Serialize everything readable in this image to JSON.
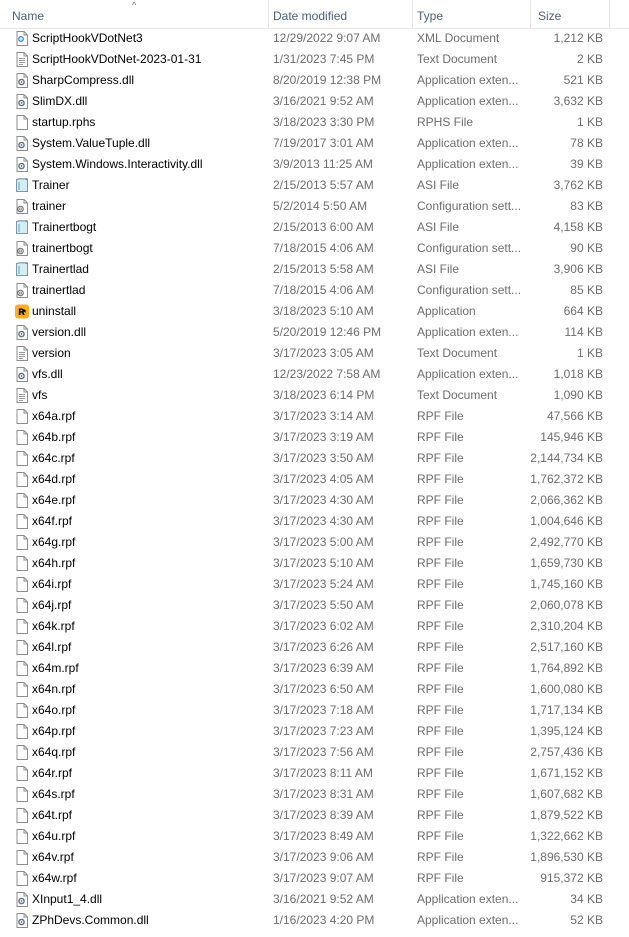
{
  "header": {
    "name": "Name",
    "date_modified": "Date modified",
    "type": "Type",
    "size": "Size",
    "sort_indicator": "^"
  },
  "files": [
    {
      "name": "ScriptHookVDotNet3",
      "date": "12/29/2022 9:07 AM",
      "type": "XML Document",
      "size": "1,212 KB",
      "icon": "xml-document-icon"
    },
    {
      "name": "ScriptHookVDotNet-2023-01-31",
      "date": "1/31/2023 7:45 PM",
      "type": "Text Document",
      "size": "2 KB",
      "icon": "text-document-icon"
    },
    {
      "name": "SharpCompress.dll",
      "date": "8/20/2019 12:38 PM",
      "type": "Application exten...",
      "size": "521 KB",
      "icon": "dll-icon"
    },
    {
      "name": "SlimDX.dll",
      "date": "3/16/2021 9:52 AM",
      "type": "Application exten...",
      "size": "3,632 KB",
      "icon": "dll-icon"
    },
    {
      "name": "startup.rphs",
      "date": "3/18/2023 3:30 PM",
      "type": "RPHS File",
      "size": "1 KB",
      "icon": "blank-file-icon"
    },
    {
      "name": "System.ValueTuple.dll",
      "date": "7/19/2017 3:01 AM",
      "type": "Application exten...",
      "size": "78 KB",
      "icon": "dll-icon"
    },
    {
      "name": "System.Windows.Interactivity.dll",
      "date": "3/9/2013 11:25 AM",
      "type": "Application exten...",
      "size": "39 KB",
      "icon": "dll-icon"
    },
    {
      "name": "Trainer",
      "date": "2/15/2013 5:57 AM",
      "type": "ASI File",
      "size": "3,762 KB",
      "icon": "asi-file-icon"
    },
    {
      "name": "trainer",
      "date": "5/2/2014 5:50 AM",
      "type": "Configuration sett...",
      "size": "83 KB",
      "icon": "config-file-icon"
    },
    {
      "name": "Trainertbogt",
      "date": "2/15/2013 6:00 AM",
      "type": "ASI File",
      "size": "4,158 KB",
      "icon": "asi-file-icon"
    },
    {
      "name": "trainertbogt",
      "date": "7/18/2015 4:06 AM",
      "type": "Configuration sett...",
      "size": "90 KB",
      "icon": "config-file-icon"
    },
    {
      "name": "Trainertlad",
      "date": "2/15/2013 5:58 AM",
      "type": "ASI File",
      "size": "3,906 KB",
      "icon": "asi-file-icon"
    },
    {
      "name": "trainertlad",
      "date": "7/18/2015 4:06 AM",
      "type": "Configuration sett...",
      "size": "85 KB",
      "icon": "config-file-icon"
    },
    {
      "name": "uninstall",
      "date": "3/18/2023 5:10 AM",
      "type": "Application",
      "size": "664 KB",
      "icon": "rockstar-app-icon"
    },
    {
      "name": "version.dll",
      "date": "5/20/2019 12:46 PM",
      "type": "Application exten...",
      "size": "114 KB",
      "icon": "dll-icon"
    },
    {
      "name": "version",
      "date": "3/17/2023 3:05 AM",
      "type": "Text Document",
      "size": "1 KB",
      "icon": "text-document-icon"
    },
    {
      "name": "vfs.dll",
      "date": "12/23/2022 7:58 AM",
      "type": "Application exten...",
      "size": "1,018 KB",
      "icon": "dll-icon"
    },
    {
      "name": "vfs",
      "date": "3/18/2023 6:14 PM",
      "type": "Text Document",
      "size": "1,090 KB",
      "icon": "text-document-icon"
    },
    {
      "name": "x64a.rpf",
      "date": "3/17/2023 3:14 AM",
      "type": "RPF File",
      "size": "47,566 KB",
      "icon": "blank-file-icon"
    },
    {
      "name": "x64b.rpf",
      "date": "3/17/2023 3:19 AM",
      "type": "RPF File",
      "size": "145,946 KB",
      "icon": "blank-file-icon"
    },
    {
      "name": "x64c.rpf",
      "date": "3/17/2023 3:50 AM",
      "type": "RPF File",
      "size": "2,144,734 KB",
      "icon": "blank-file-icon"
    },
    {
      "name": "x64d.rpf",
      "date": "3/17/2023 4:05 AM",
      "type": "RPF File",
      "size": "1,762,372 KB",
      "icon": "blank-file-icon"
    },
    {
      "name": "x64e.rpf",
      "date": "3/17/2023 4:30 AM",
      "type": "RPF File",
      "size": "2,066,362 KB",
      "icon": "blank-file-icon"
    },
    {
      "name": "x64f.rpf",
      "date": "3/17/2023 4:30 AM",
      "type": "RPF File",
      "size": "1,004,646 KB",
      "icon": "blank-file-icon"
    },
    {
      "name": "x64g.rpf",
      "date": "3/17/2023 5:00 AM",
      "type": "RPF File",
      "size": "2,492,770 KB",
      "icon": "blank-file-icon"
    },
    {
      "name": "x64h.rpf",
      "date": "3/17/2023 5:10 AM",
      "type": "RPF File",
      "size": "1,659,730 KB",
      "icon": "blank-file-icon"
    },
    {
      "name": "x64i.rpf",
      "date": "3/17/2023 5:24 AM",
      "type": "RPF File",
      "size": "1,745,160 KB",
      "icon": "blank-file-icon"
    },
    {
      "name": "x64j.rpf",
      "date": "3/17/2023 5:50 AM",
      "type": "RPF File",
      "size": "2,060,078 KB",
      "icon": "blank-file-icon"
    },
    {
      "name": "x64k.rpf",
      "date": "3/17/2023 6:02 AM",
      "type": "RPF File",
      "size": "2,310,204 KB",
      "icon": "blank-file-icon"
    },
    {
      "name": "x64l.rpf",
      "date": "3/17/2023 6:26 AM",
      "type": "RPF File",
      "size": "2,517,160 KB",
      "icon": "blank-file-icon"
    },
    {
      "name": "x64m.rpf",
      "date": "3/17/2023 6:39 AM",
      "type": "RPF File",
      "size": "1,764,892 KB",
      "icon": "blank-file-icon"
    },
    {
      "name": "x64n.rpf",
      "date": "3/17/2023 6:50 AM",
      "type": "RPF File",
      "size": "1,600,080 KB",
      "icon": "blank-file-icon"
    },
    {
      "name": "x64o.rpf",
      "date": "3/17/2023 7:18 AM",
      "type": "RPF File",
      "size": "1,717,134 KB",
      "icon": "blank-file-icon"
    },
    {
      "name": "x64p.rpf",
      "date": "3/17/2023 7:23 AM",
      "type": "RPF File",
      "size": "1,395,124 KB",
      "icon": "blank-file-icon"
    },
    {
      "name": "x64q.rpf",
      "date": "3/17/2023 7:56 AM",
      "type": "RPF File",
      "size": "2,757,436 KB",
      "icon": "blank-file-icon"
    },
    {
      "name": "x64r.rpf",
      "date": "3/17/2023 8:11 AM",
      "type": "RPF File",
      "size": "1,671,152 KB",
      "icon": "blank-file-icon"
    },
    {
      "name": "x64s.rpf",
      "date": "3/17/2023 8:31 AM",
      "type": "RPF File",
      "size": "1,607,682 KB",
      "icon": "blank-file-icon"
    },
    {
      "name": "x64t.rpf",
      "date": "3/17/2023 8:39 AM",
      "type": "RPF File",
      "size": "1,879,522 KB",
      "icon": "blank-file-icon"
    },
    {
      "name": "x64u.rpf",
      "date": "3/17/2023 8:49 AM",
      "type": "RPF File",
      "size": "1,322,662 KB",
      "icon": "blank-file-icon"
    },
    {
      "name": "x64v.rpf",
      "date": "3/17/2023 9:06 AM",
      "type": "RPF File",
      "size": "1,896,530 KB",
      "icon": "blank-file-icon"
    },
    {
      "name": "x64w.rpf",
      "date": "3/17/2023 9:07 AM",
      "type": "RPF File",
      "size": "915,372 KB",
      "icon": "blank-file-icon"
    },
    {
      "name": "XInput1_4.dll",
      "date": "3/16/2021 9:52 AM",
      "type": "Application exten...",
      "size": "34 KB",
      "icon": "dll-icon"
    },
    {
      "name": "ZPhDevs.Common.dll",
      "date": "1/16/2023 4:20 PM",
      "type": "Application exten...",
      "size": "52 KB",
      "icon": "dll-icon"
    }
  ],
  "colors": {
    "header_text": "#4c607a",
    "secondary_text": "#6d6d6d",
    "rockstar_yellow": "#fcaf17"
  }
}
